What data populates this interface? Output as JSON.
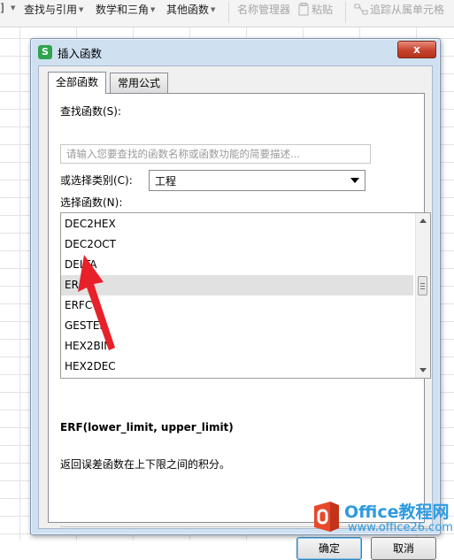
{
  "ribbon": {
    "partial_left": "]",
    "items": [
      {
        "label": "查找与引用",
        "enabled": true
      },
      {
        "label": "数学和三角",
        "enabled": true
      },
      {
        "label": "其他函数",
        "enabled": true
      },
      {
        "label": "名称管理器",
        "enabled": false
      },
      {
        "label": "粘贴",
        "enabled": false
      },
      {
        "label": "追踪从属单元格",
        "enabled": false
      }
    ]
  },
  "dialog": {
    "title": "插入函数",
    "app_icon": "S",
    "close_icon": "x",
    "tabs": [
      {
        "label": "全部函数",
        "active": true
      },
      {
        "label": "常用公式",
        "active": false
      }
    ],
    "search": {
      "label": "查找函数(S):",
      "placeholder": "请输入您要查找的函数名称或函数功能的简要描述...",
      "value": ""
    },
    "category": {
      "label": "或选择类别(C):",
      "selected": "工程"
    },
    "function_list": {
      "label": "选择函数(N):",
      "items": [
        "DEC2HEX",
        "DEC2OCT",
        "DELTA",
        "ERF",
        "ERFC",
        "GESTEP",
        "HEX2BIN",
        "HEX2DEC"
      ],
      "selected": "ERF"
    },
    "signature": "ERF(lower_limit, upper_limit)",
    "description": "返回误差函数在上下限之间的积分。",
    "ok_label": "确定",
    "cancel_label": "取消"
  },
  "annotation": {
    "arrow_color": "#e8202a"
  },
  "watermark": {
    "title": "Office教程网",
    "url": "www.office26.com",
    "brand_color": "#2d9be0",
    "logo_color": "#e8492b"
  }
}
